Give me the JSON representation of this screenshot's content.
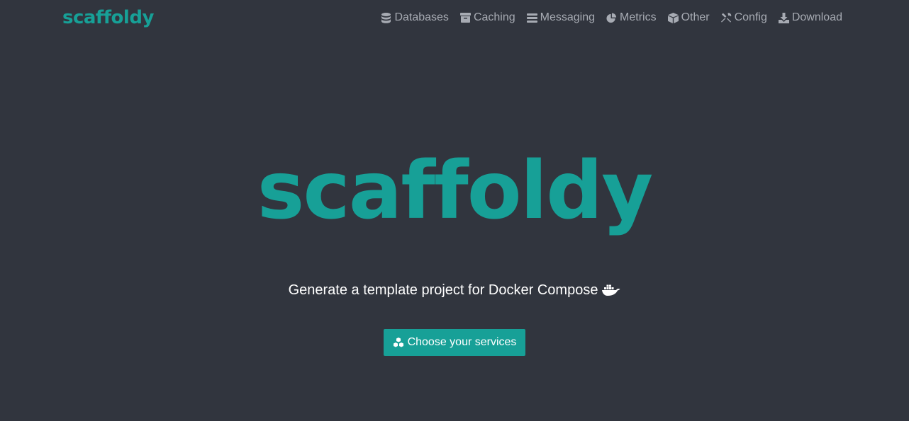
{
  "brand": {
    "name": "scaffoldy"
  },
  "nav": {
    "items": [
      {
        "label": "Databases",
        "icon": "database-icon"
      },
      {
        "label": "Caching",
        "icon": "archive-icon"
      },
      {
        "label": "Messaging",
        "icon": "bars-icon"
      },
      {
        "label": "Metrics",
        "icon": "pie-chart-icon"
      },
      {
        "label": "Other",
        "icon": "cube-icon"
      },
      {
        "label": "Config",
        "icon": "tools-icon"
      },
      {
        "label": "Download",
        "icon": "download-icon"
      }
    ]
  },
  "hero": {
    "logo": "scaffoldy",
    "tagline": "Generate a template project for Docker Compose",
    "tagline_icon": "docker-whale-icon",
    "cta_label": "Choose your services",
    "cta_icon": "cubes-icon"
  },
  "colors": {
    "background": "#31353e",
    "accent": "#17a097",
    "nav_text": "#a7abb3"
  }
}
